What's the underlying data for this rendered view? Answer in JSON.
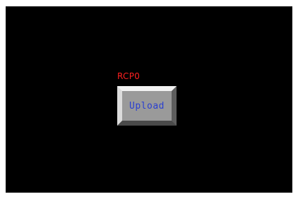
{
  "screen": {
    "background_color": "#000000",
    "recipe_label": "RCP0",
    "recipe_label_color": "#ff2020",
    "upload_button": {
      "label": "Upload",
      "text_color": "#2a3fd0",
      "face_color": "#9a9a9a"
    }
  }
}
